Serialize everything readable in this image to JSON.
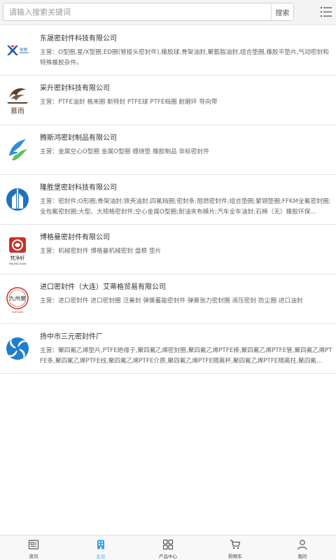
{
  "search": {
    "placeholder": "请输入搜索关键词",
    "button_label": "搜索"
  },
  "companies": [
    {
      "name": "东晟密封件科技有限公司",
      "description": "主营：O型圈,星/X型圈,ED圈(管接头密封件),橡胶球,骨架油封,聚氨脂油封,组合垫圈,橡胶平垫片,气动密封和特殊橡胶杂件。",
      "logo": "dongsheng-logo",
      "logo_text": "创想"
    },
    {
      "name": "采升密封科技有限公司",
      "description": "主营：PTFE油封 格来圈 斯特封 PTFE球 PTFE档圈 耐磨环 导向带",
      "logo": "caisheng-logo",
      "logo_text": "慕雨"
    },
    {
      "name": "腾斯鸿密封制品有限公司",
      "description": "主营：金属空心O型圈 金属O型圈 缠绕垫 橡胶制品 非标密封件",
      "logo": "tengsihong-logo"
    },
    {
      "name": "隆胜堡密封科技有限公司",
      "description": "主营：密封件;O形圈;骨架油封;铁壳油封;四氟档圈;密封条;阻燃密封件;组合垫圈;紫铜垫圈;FFKM全氟密封圈;全包氟密封圈;大型、大规格密封件;空心金属O型圈;耐油夹布模片;汽车全车油封;石棉（无）橡胶环保...",
      "logo": "longshengbao-logo"
    },
    {
      "name": "博格曼密封件有限公司",
      "description": "主营：机械密封件 博格曼机械密封 盘根 垫片",
      "logo": "bogeman-logo",
      "logo_text": "梵净轩",
      "logo_sub": "FAN JING XUAN"
    },
    {
      "name": "进口密封件（大连）艾蒂格贸易有限公司",
      "description": "主营：进口密封件 进口密封圈 泛塞封 弹簧蓄能密封件 弹簧张力密封圈 液压密封 防尘圈 进口油封",
      "logo": "aidige-logo",
      "logo_text": "九州泉",
      "logo_sub": "QIUYUAN"
    },
    {
      "name": "扬中市三元密封件厂",
      "description": "主营：聚四氟乙烯垫片,PTFE绝缘子,聚四氟乙烯密封圈,聚四氟乙烯PTFE棒,聚四氟乙烯PTFE管,聚四氟乙烯PTFE条,聚四氟乙烯PTFE线,聚四氟乙烯PTFE介质,聚四氟乙烯PTFE隔离杯,聚四氟乙烯PTFE隔离柱,聚四氟...",
      "logo": "sanyuan-logo"
    }
  ],
  "bottom_nav": [
    {
      "label": "资讯",
      "icon": "news-icon",
      "active": false
    },
    {
      "label": "企业",
      "icon": "enterprise-icon",
      "active": true
    },
    {
      "label": "产品中心",
      "icon": "products-icon",
      "active": false
    },
    {
      "label": "购物车",
      "icon": "cart-icon",
      "active": false
    },
    {
      "label": "我的",
      "icon": "profile-icon",
      "active": false
    }
  ],
  "colors": {
    "accent": "#3aa0e6",
    "text_primary": "#333333",
    "text_secondary": "#666666"
  }
}
